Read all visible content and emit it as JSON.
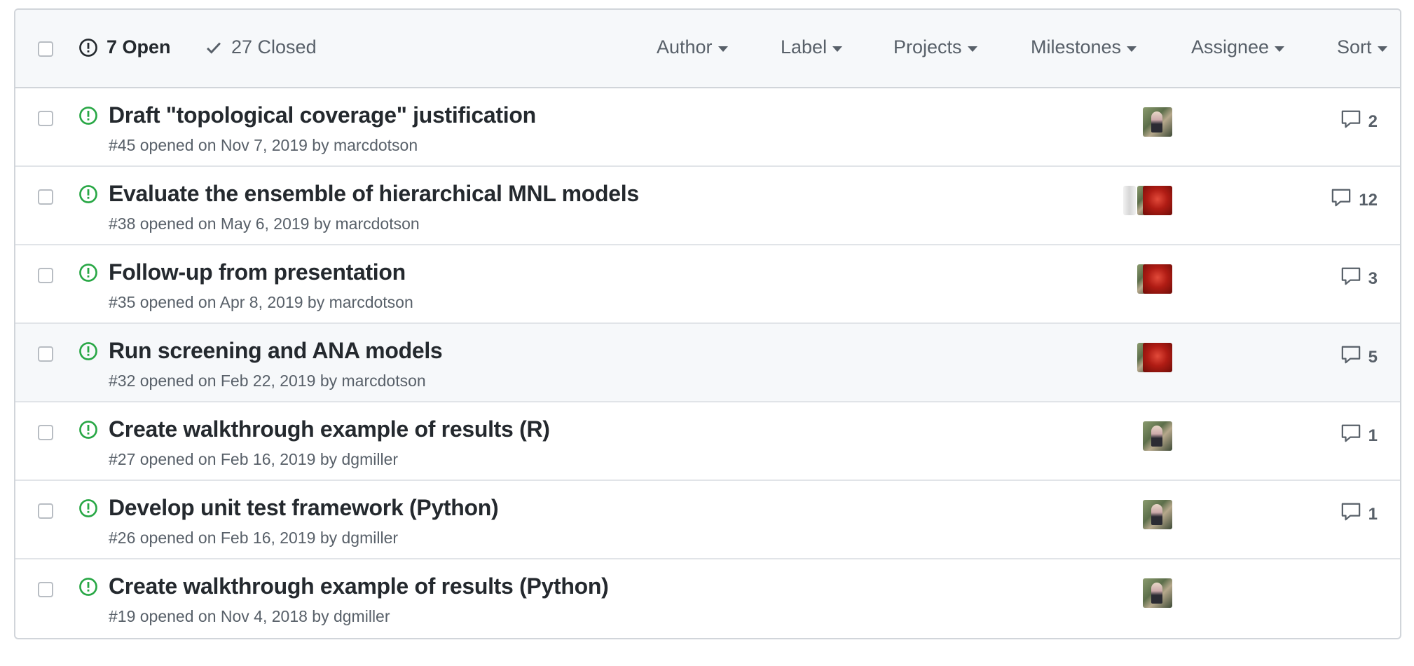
{
  "header": {
    "open_label": "7 Open",
    "closed_label": "27 Closed",
    "filters": [
      "Author",
      "Label",
      "Projects",
      "Milestones",
      "Assignee",
      "Sort"
    ]
  },
  "issues": [
    {
      "title": "Draft \"topological coverage\" justification",
      "meta": "#45 opened on Nov 7, 2019 by marcdotson",
      "comments": "2",
      "assignees": [
        "man"
      ]
    },
    {
      "title": "Evaluate the ensemble of hierarchical MNL models",
      "meta": "#38 opened on May 6, 2019 by marcdotson",
      "comments": "12",
      "assignees": [
        "faded",
        "man-thin",
        "red"
      ]
    },
    {
      "title": "Follow-up from presentation",
      "meta": "#35 opened on Apr 8, 2019 by marcdotson",
      "comments": "3",
      "assignees": [
        "man-thin",
        "red"
      ]
    },
    {
      "title": "Run screening and ANA models",
      "meta": "#32 opened on Feb 22, 2019 by marcdotson",
      "comments": "5",
      "assignees": [
        "man-thin",
        "red"
      ]
    },
    {
      "title": "Create walkthrough example of results (R)",
      "meta": "#27 opened on Feb 16, 2019 by dgmiller",
      "comments": "1",
      "assignees": [
        "man"
      ]
    },
    {
      "title": "Develop unit test framework (Python)",
      "meta": "#26 opened on Feb 16, 2019 by dgmiller",
      "comments": "1",
      "assignees": [
        "man"
      ]
    },
    {
      "title": "Create walkthrough example of results (Python)",
      "meta": "#19 opened on Nov 4, 2018 by dgmiller",
      "comments": "",
      "assignees": [
        "man"
      ]
    }
  ],
  "colors": {
    "open_green": "#28a745",
    "text_muted": "#586069",
    "border": "#d1d5da",
    "header_bg": "#f6f8fa"
  },
  "icons": {
    "open": "issue-opened-icon",
    "closed": "check-icon",
    "comment": "comment-icon"
  }
}
